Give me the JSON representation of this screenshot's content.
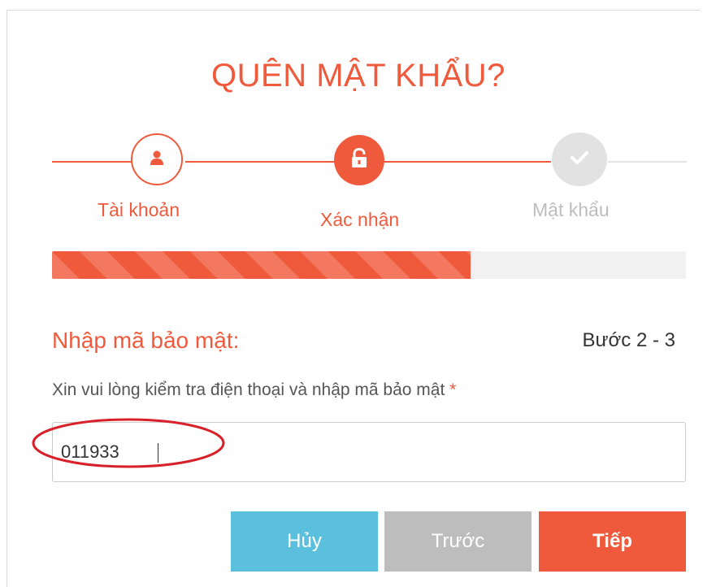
{
  "title": "QUÊN MẬT KHẨU?",
  "stepper": {
    "steps": [
      {
        "label": "Tài khoản",
        "icon": "user-icon",
        "status": "completed"
      },
      {
        "label": "Xác nhận",
        "icon": "unlock-icon",
        "status": "active"
      },
      {
        "label": "Mật khẩu",
        "icon": "check-icon",
        "status": "pending"
      }
    ]
  },
  "progress": {
    "percent": 66
  },
  "form": {
    "heading": "Nhập mã bảo mật:",
    "step_counter": "Bước 2 - 3",
    "field_label": "Xin vui lòng kiểm tra điện thoại và nhập mã bảo mật",
    "required_marker": "*",
    "code_value": "011933"
  },
  "buttons": {
    "cancel": "Hủy",
    "previous": "Trước",
    "next": "Tiếp"
  },
  "colors": {
    "accent": "#f05a3c",
    "cancel": "#5bc0de",
    "previous": "#bdbdbd",
    "inactive": "#e2e2e2",
    "annotation": "#d8202a"
  }
}
